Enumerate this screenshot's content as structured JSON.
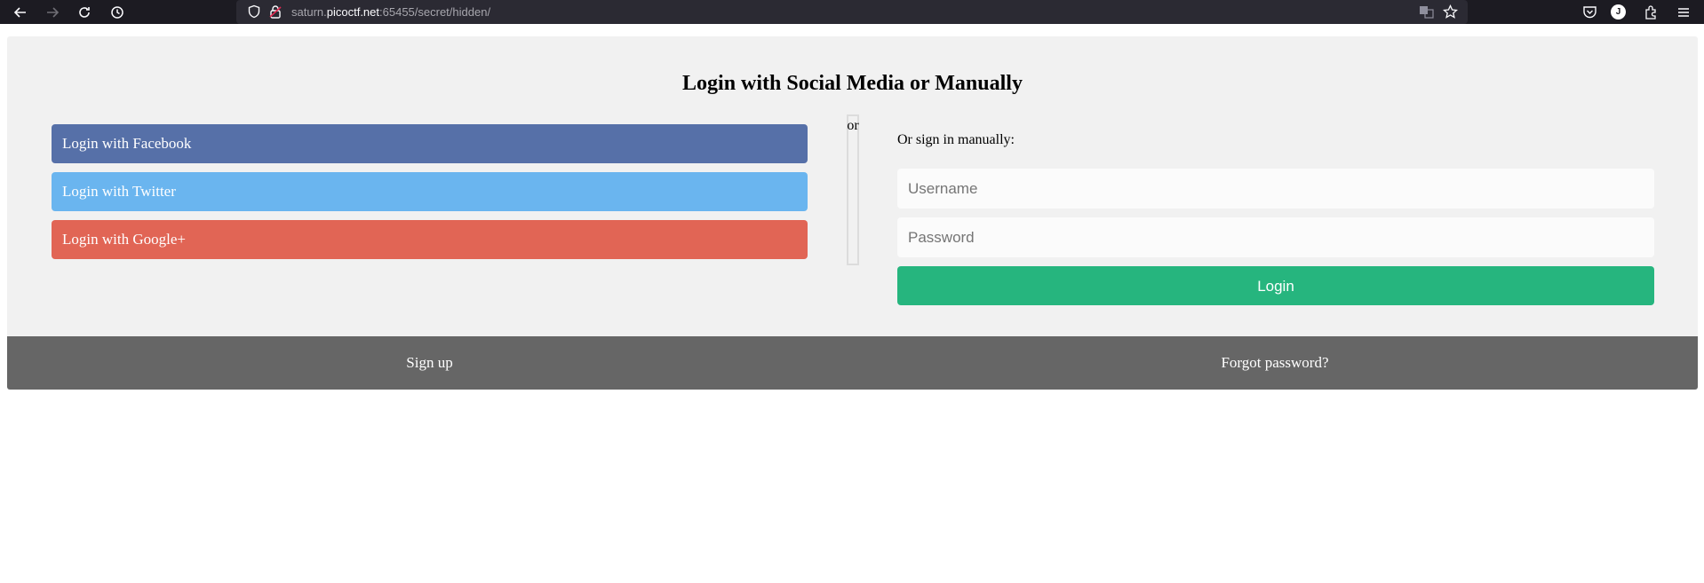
{
  "browser": {
    "url_prefix": "saturn.",
    "url_domain": "picoctf.net",
    "url_suffix": ":65455/secret/hidden/",
    "profile_initial": "J",
    "icons": [
      "back-arrow-icon",
      "forward-arrow-icon",
      "reload-icon",
      "history-icon",
      "shield-icon",
      "lock-icon",
      "translate-icon",
      "bookmark-star-icon",
      "pocket-icon",
      "extensions-icon",
      "menu-icon"
    ]
  },
  "page": {
    "title": "Login with Social Media or Manually",
    "social": {
      "facebook_label": "Login with Facebook",
      "twitter_label": "Login with Twitter",
      "google_label": "Login with Google+"
    },
    "divider_text": "or",
    "manual_label": "Or sign in manually:",
    "username_placeholder": "Username",
    "password_placeholder": "Password",
    "login_label": "Login",
    "signup_label": "Sign up",
    "forgot_label": "Forgot password?"
  },
  "colors": {
    "facebook": "#5670a8",
    "twitter": "#6ab5ef",
    "google": "#e16555",
    "login": "#26b57e",
    "footer": "#666666",
    "card": "#f1f1f1"
  }
}
